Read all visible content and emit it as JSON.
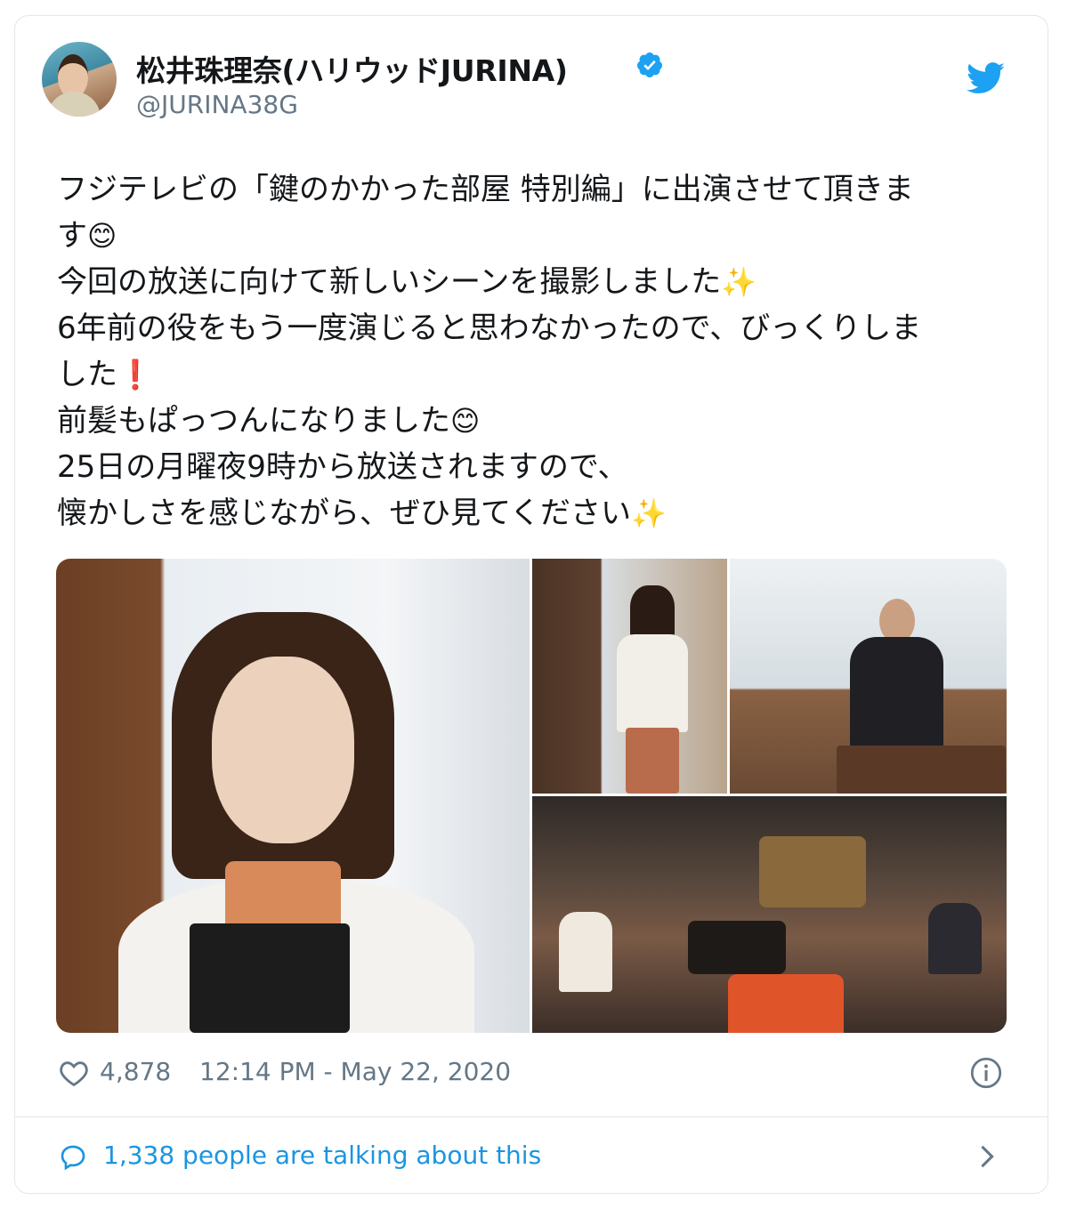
{
  "author": {
    "display_name": "松井珠理奈(ハリウッドJURINA)",
    "handle": "@JURINA38G",
    "verified": true
  },
  "icons": {
    "brand": "twitter-bird-icon",
    "verified": "verified-badge-icon",
    "like": "heart-icon",
    "info": "info-icon",
    "reply": "speech-bubble-icon",
    "more": "chevron-right-icon"
  },
  "tweet": {
    "lines": [
      "フジテレビの「鍵のかかった部屋 特別編」に出演させて頂きま",
      "す",
      "今回の放送に向けて新しいシーンを撮影しました",
      "6年前の役をもう一度演じると思わなかったので、びっくりしま",
      "した",
      "前髪もぱっつんになりました",
      "25日の月曜夜9時から放送されますので、",
      "懐かしさを感じながら、ぜひ見てください"
    ],
    "emojis": {
      "smile": "😊",
      "sparkles": "✨",
      "exclamation": "❗"
    }
  },
  "media": {
    "photo_count": 4
  },
  "stats": {
    "likes": "4,878",
    "timestamp": "12:14 PM - May 22, 2020"
  },
  "conversation": {
    "label": "1,338 people are talking about this"
  },
  "colors": {
    "twitter_blue": "#1da1f2",
    "link_blue": "#1b95e0",
    "secondary_text": "#657786",
    "border": "#e1e8ed"
  }
}
